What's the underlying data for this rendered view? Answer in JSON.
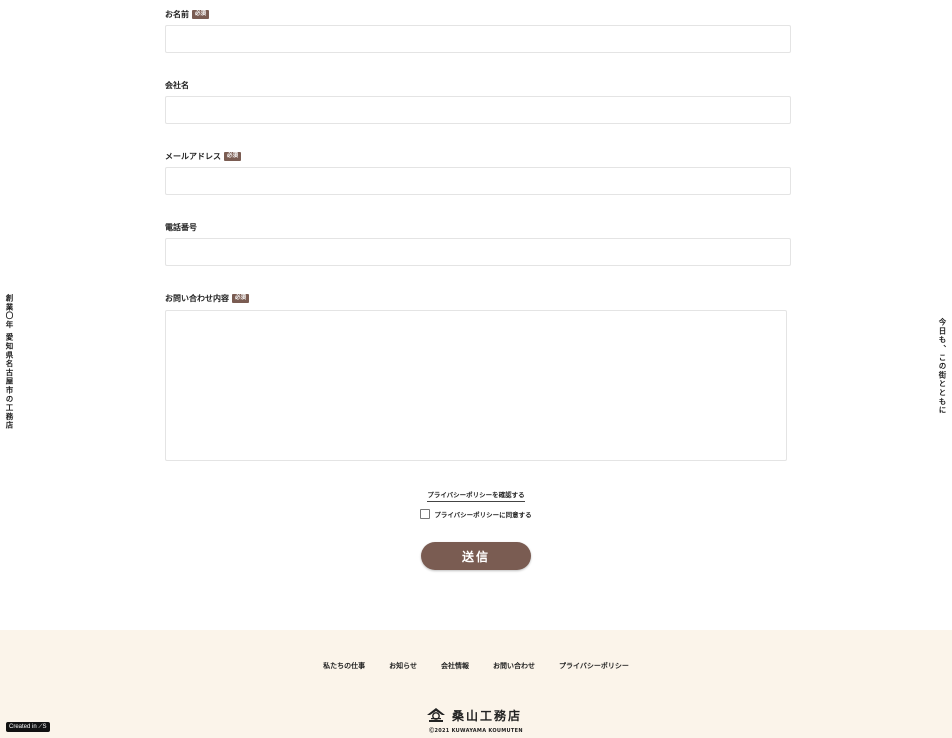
{
  "side_left_text": "創業〇年 愛知県名古屋市の工務店",
  "side_right_text": "今日も、この街とともに",
  "form": {
    "required_badge": "必須",
    "fields": {
      "name": {
        "label": "お名前",
        "value": ""
      },
      "company": {
        "label": "会社名",
        "value": ""
      },
      "email": {
        "label": "メールアドレス",
        "value": ""
      },
      "phone": {
        "label": "電話番号",
        "value": ""
      },
      "inquiry": {
        "label": "お問い合わせ内容",
        "value": ""
      }
    },
    "privacy_link": "プライバシーポリシーを確認する",
    "consent_label": "プライバシーポリシーに同意する",
    "consent_checked": false,
    "submit_label": "送信"
  },
  "footer": {
    "nav": [
      "私たちの仕事",
      "お知らせ",
      "会社情報",
      "お問い合わせ",
      "プライバシーポリシー"
    ],
    "logo_text": "桑山工務店",
    "copyright": "Ⓒ2021 KUWAYAMA KOUMUTEN",
    "background": "#fbf4ea"
  },
  "badge_created": "Created in ⟋S",
  "colors": {
    "accent": "#7a5c52"
  }
}
